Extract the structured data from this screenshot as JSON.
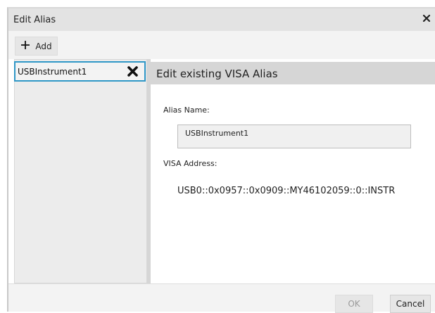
{
  "dialog": {
    "title": "Edit Alias",
    "close_icon": "close-icon"
  },
  "toolbar": {
    "add_label": "Add",
    "add_icon": "plus-icon"
  },
  "alias_list": {
    "items": [
      {
        "label": "USBInstrument1",
        "selected": true,
        "delete_icon": "delete-x-icon"
      }
    ]
  },
  "editor": {
    "header": "Edit existing VISA Alias",
    "alias_name_label": "Alias Name:",
    "alias_name_value": "USBInstrument1",
    "visa_address_label": "VISA Address:",
    "visa_address_value": "USB0::0x0957::0x0909::MY46102059::0::INSTR"
  },
  "footer": {
    "ok_label": "OK",
    "ok_enabled": false,
    "cancel_label": "Cancel"
  },
  "colors": {
    "selection_border": "#2f97c7",
    "header_bg": "#d6d6d6",
    "titlebar_bg": "#e3e3e3"
  }
}
